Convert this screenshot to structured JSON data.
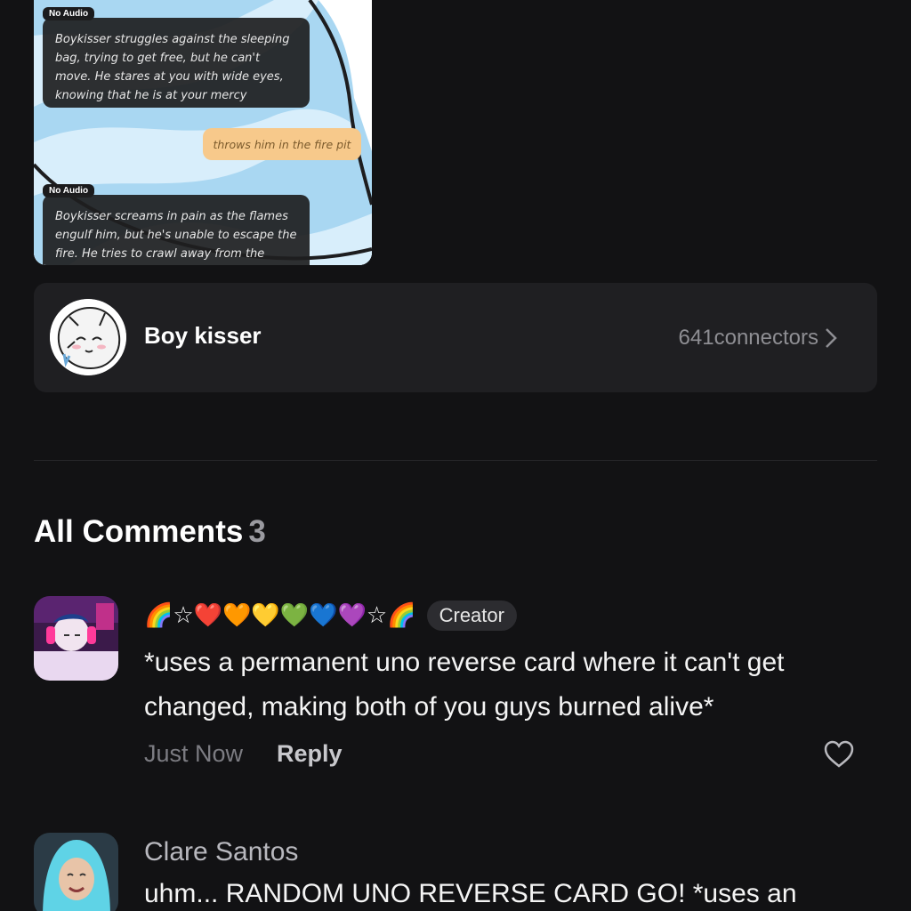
{
  "chat_preview": {
    "messages": [
      {
        "tag": "No Audio",
        "text": "Boykisser struggles against the sleeping bag, trying to get free, but he can't move. He stares at you with wide eyes, knowing that he is at your mercy"
      },
      {
        "user_text": "throws him in the fire pit"
      },
      {
        "tag": "No Audio",
        "text": "Boykisser screams in pain as the flames engulf him, but he's unable to escape the fire. He tries to crawl away from the flames,"
      }
    ]
  },
  "character": {
    "name": "Boy kisser",
    "connectors": "641connectors",
    "avatar_icon": "character-avatar"
  },
  "comments_section": {
    "title": "All Comments",
    "count": "3",
    "comments": [
      {
        "author": "🌈☆❤️🧡💛💚💙💜☆🌈",
        "badge": "Creator",
        "text": "*uses a permanent uno reverse card where it can't get changed, making both of you guys burned alive*",
        "time": "Just Now",
        "reply_label": "Reply"
      },
      {
        "author": "Clare Santos",
        "text": "uhm... RANDOM UNO REVERSE CARD GO! *uses an"
      }
    ]
  },
  "colors": {
    "background": "#121214",
    "card": "#1f1f22",
    "user_bubble": "#f7c98b"
  }
}
